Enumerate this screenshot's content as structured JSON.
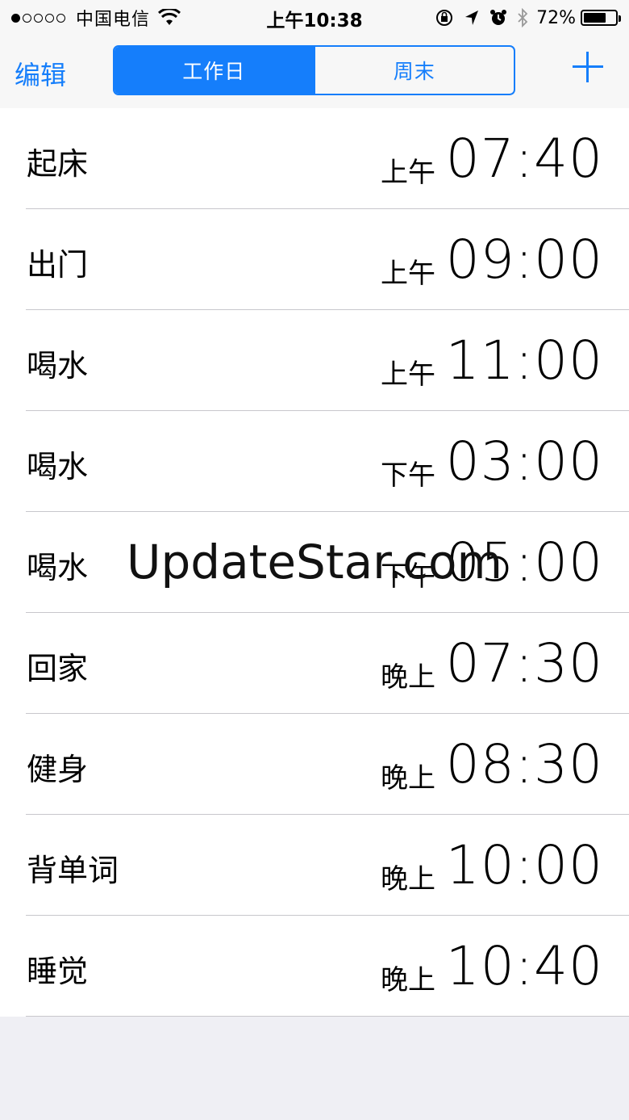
{
  "status_bar": {
    "carrier": "中国电信",
    "time": "上午10:38",
    "battery_pct": "72%",
    "battery_level": 0.72
  },
  "nav": {
    "edit_label": "编辑",
    "segments": [
      "工作日",
      "周末"
    ],
    "active_segment": 0,
    "add_icon": "plus-icon"
  },
  "alarms": [
    {
      "label": "起床",
      "period": "上午",
      "time": "07:40"
    },
    {
      "label": "出门",
      "period": "上午",
      "time": "09:00"
    },
    {
      "label": "喝水",
      "period": "上午",
      "time": "11:00"
    },
    {
      "label": "喝水",
      "period": "下午",
      "time": "03:00"
    },
    {
      "label": "喝水",
      "period": "下午",
      "time": "05:00"
    },
    {
      "label": "回家",
      "period": "晚上",
      "time": "07:30"
    },
    {
      "label": "健身",
      "period": "晚上",
      "time": "08:30"
    },
    {
      "label": "背单词",
      "period": "晚上",
      "time": "10:00"
    },
    {
      "label": "睡觉",
      "period": "晚上",
      "time": "10:40"
    }
  ],
  "watermark": "UpdateStar.com",
  "colors": {
    "accent": "#157efb",
    "background": "#efeff4",
    "separator": "#c8c7cc"
  }
}
